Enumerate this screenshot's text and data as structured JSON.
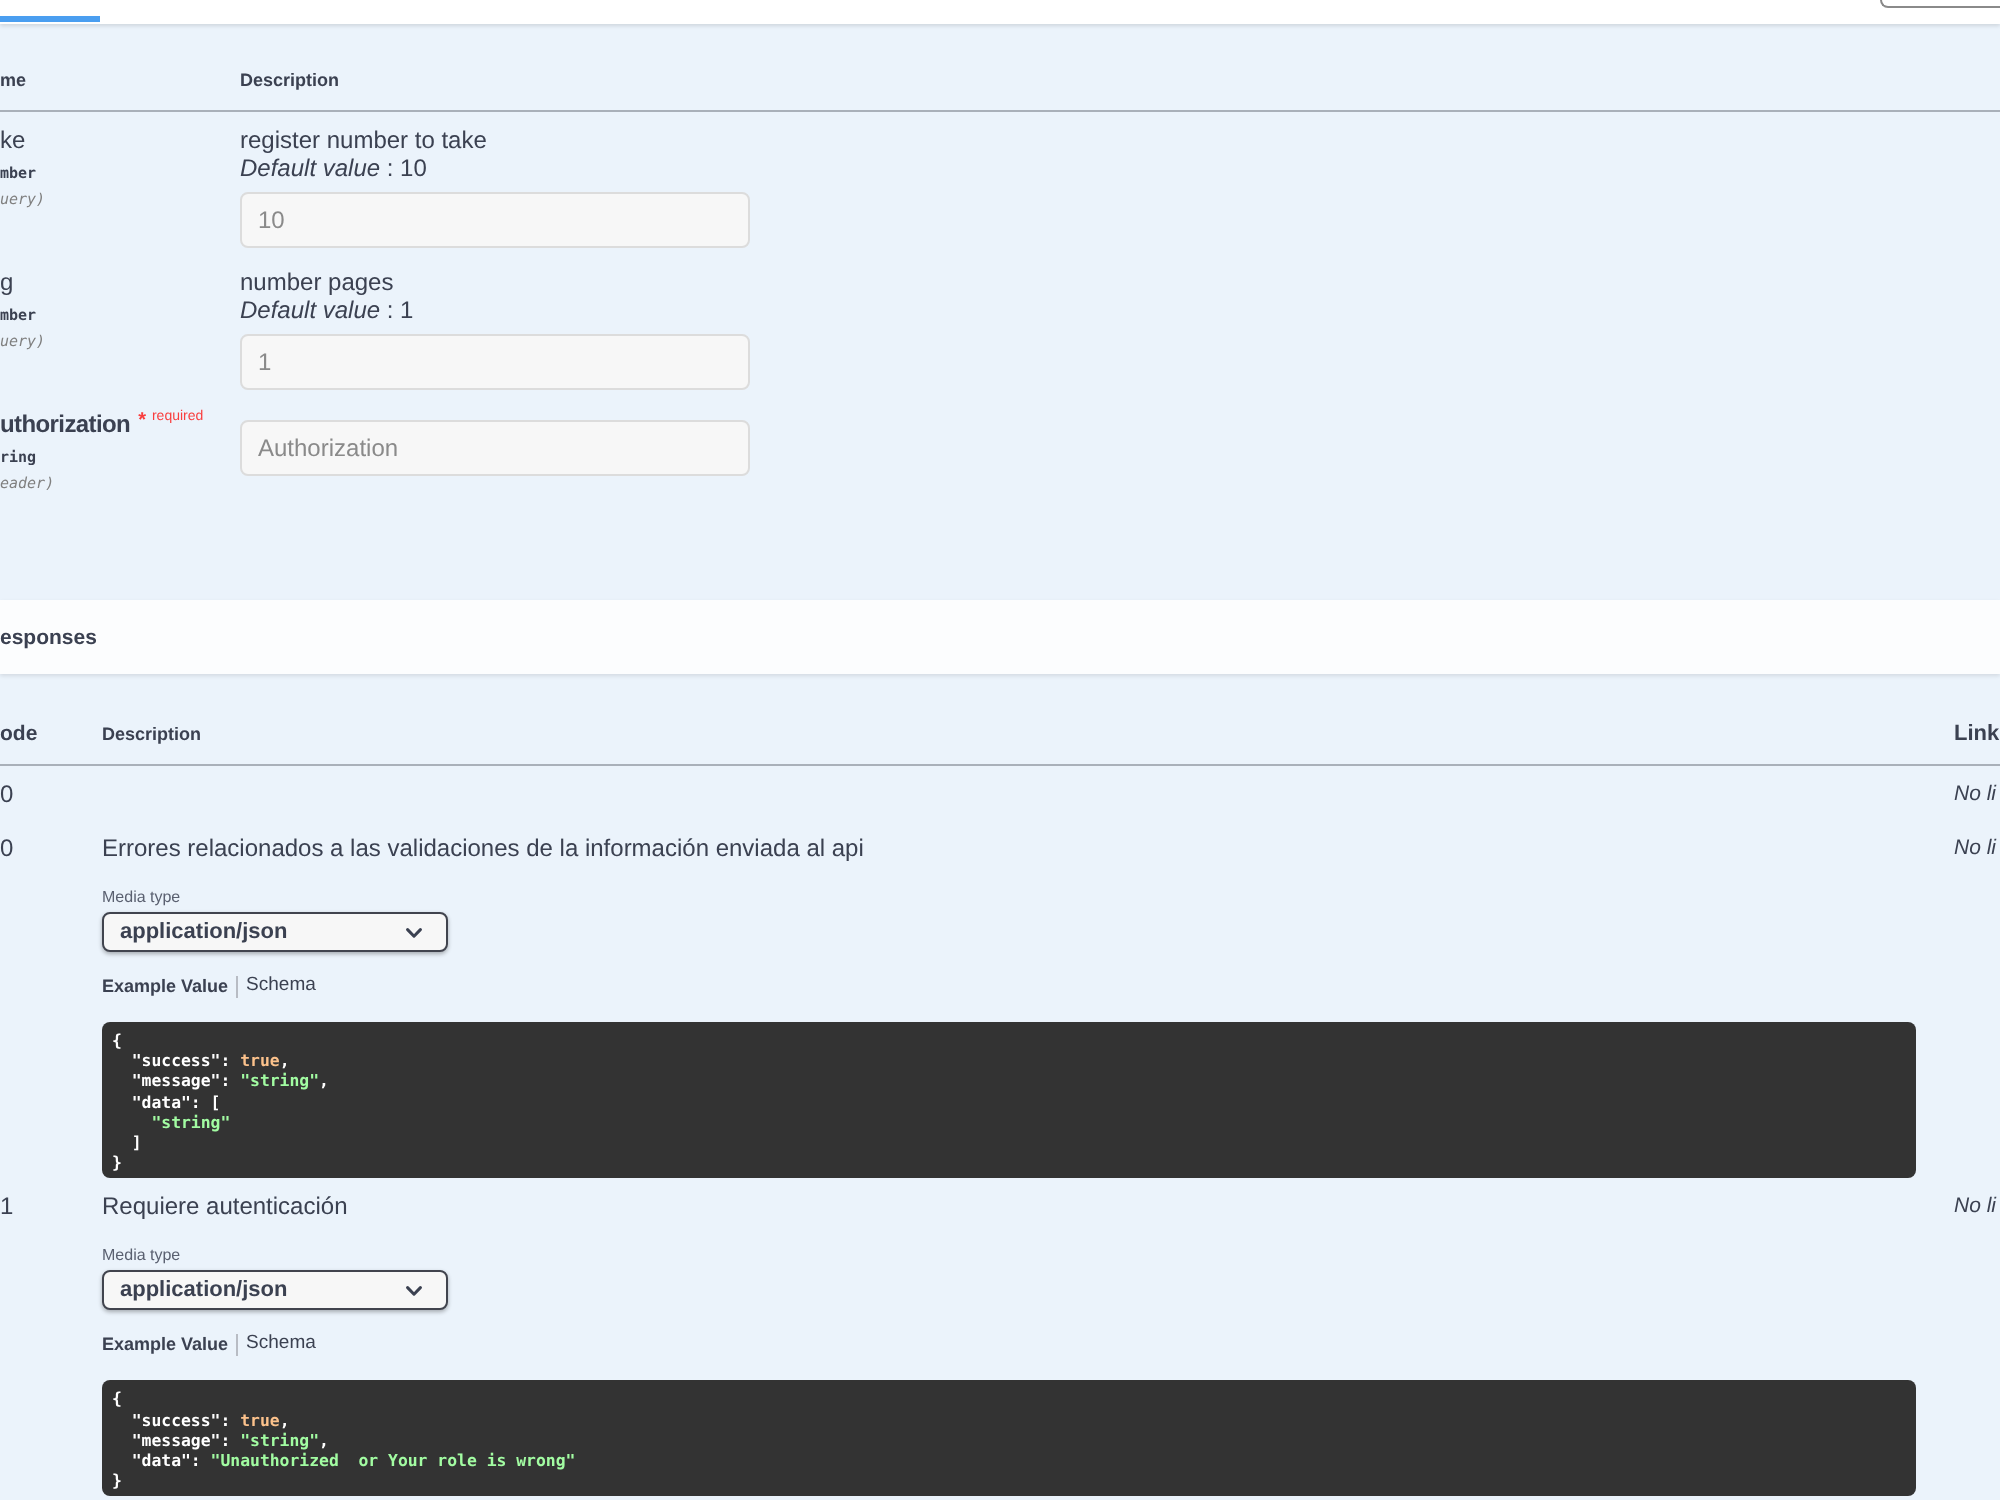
{
  "parameters": {
    "columns": [
      "me",
      "Description"
    ],
    "rows": [
      {
        "name": "ke",
        "required": false,
        "type": "mber",
        "location": "uery)",
        "description": "register number to take",
        "default": "*Default value* : 10",
        "input": {
          "value": "10",
          "disabled": true
        }
      },
      {
        "name": "g",
        "required": false,
        "type": "mber",
        "location": "uery)",
        "description": "number pages",
        "default": "*Default value* : 1",
        "input": {
          "value": "1",
          "disabled": true
        }
      },
      {
        "name": "uthorization",
        "required": true,
        "required_mark": "*",
        "required_label": "required",
        "type": "ring",
        "location": "eader)",
        "input": {
          "placeholder": "Authorization",
          "disabled": true
        }
      }
    ]
  },
  "responses": {
    "title": "esponses",
    "columns": [
      "ode",
      "Description",
      "Link"
    ],
    "rows": [
      {
        "code": "0",
        "links": "No li"
      },
      {
        "code": "0",
        "description": "Errores relacionados a las validaciones de la información enviada al api",
        "links": "No li",
        "media_type_label": "Media type",
        "media_type": "application/json",
        "example_tabs": [
          {
            "label": "Example Value",
            "selected": true
          },
          {
            "label": "Schema",
            "selected": false
          }
        ],
        "example": [
          [
            {
              "kind": "plain",
              "text": "{"
            }
          ],
          [
            {
              "kind": "plain",
              "text": "  \"success\": "
            },
            {
              "kind": "bool",
              "text": "true"
            },
            {
              "kind": "plain",
              "text": ","
            }
          ],
          [
            {
              "kind": "plain",
              "text": "  \"message\": "
            },
            {
              "kind": "string",
              "text": "\"string\""
            },
            {
              "kind": "plain",
              "text": ","
            }
          ],
          [
            {
              "kind": "plain",
              "text": "  \"data\": ["
            }
          ],
          [
            {
              "kind": "string",
              "text": "    \"string\""
            }
          ],
          [
            {
              "kind": "plain",
              "text": "  ]"
            }
          ],
          [
            {
              "kind": "plain",
              "text": "}"
            }
          ]
        ]
      },
      {
        "code": "1",
        "description": "Requiere autenticación",
        "links": "No li",
        "media_type_label": "Media type",
        "media_type": "application/json",
        "example_tabs": [
          {
            "label": "Example Value",
            "selected": true
          },
          {
            "label": "Schema",
            "selected": false
          }
        ],
        "example": [
          [
            {
              "kind": "plain",
              "text": "{"
            }
          ],
          [
            {
              "kind": "plain",
              "text": "  \"success\": "
            },
            {
              "kind": "bool",
              "text": "true"
            },
            {
              "kind": "plain",
              "text": ","
            }
          ],
          [
            {
              "kind": "plain",
              "text": "  \"message\": "
            },
            {
              "kind": "string",
              "text": "\"string\""
            },
            {
              "kind": "plain",
              "text": ","
            }
          ],
          [
            {
              "kind": "plain",
              "text": "  \"data\": "
            },
            {
              "kind": "string",
              "text": "\"Unauthorized  or Your role is wrong\""
            }
          ],
          [
            {
              "kind": "plain",
              "text": "}"
            }
          ]
        ]
      }
    ]
  }
}
